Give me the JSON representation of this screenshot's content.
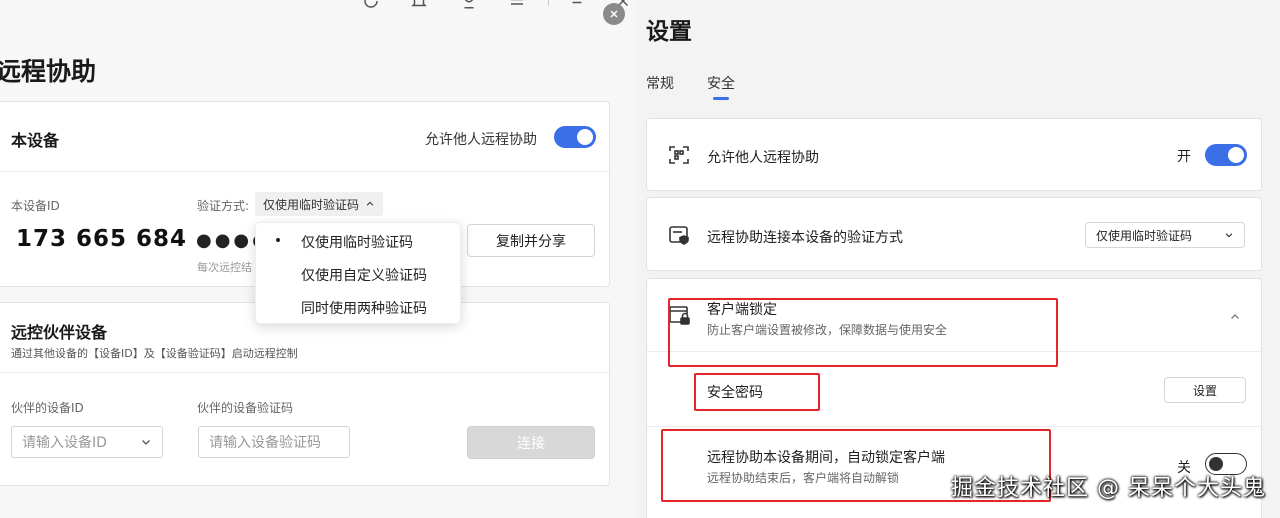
{
  "left": {
    "title": "远程协助",
    "device_card": {
      "title": "本设备",
      "allow_label": "允许他人远程协助",
      "allow_enabled": true,
      "id_label": "本设备ID",
      "device_id": "173 665 684",
      "verify_label": "验证方式:",
      "verify_value": "仅使用临时验证码",
      "password_masked": "●●●●",
      "password_hint": "每次远控结",
      "copy_button": "复制并分享",
      "verify_options": [
        "仅使用临时验证码",
        "仅使用自定义验证码",
        "同时使用两种验证码"
      ],
      "selected_option": 0
    },
    "partner_card": {
      "title": "远控伙伴设备",
      "subtitle": "通过其他设备的【设备ID】及【设备验证码】启动远程控制",
      "partner_id_label": "伙伴的设备ID",
      "partner_id_placeholder": "请输入设备ID",
      "partner_code_label": "伙伴的设备验证码",
      "partner_code_placeholder": "请输入设备验证码",
      "connect_button": "连接"
    }
  },
  "right": {
    "title": "设置",
    "tabs": [
      {
        "label": "常规",
        "active": false
      },
      {
        "label": "安全",
        "active": true
      }
    ],
    "allow_row": {
      "label": "允许他人远程协助",
      "state_label": "开",
      "enabled": true
    },
    "verify_row": {
      "label": "远程协助连接本设备的验证方式",
      "select_value": "仅使用临时验证码"
    },
    "lock_section": {
      "title": "客户端锁定",
      "subtitle": "防止客户端设置被修改，保障数据与使用安全",
      "password_label": "安全密码",
      "password_button": "设置",
      "auto_lock_label": "远程协助本设备期间，自动锁定客户端",
      "auto_lock_sub": "远程协助结束后，客户端将自动解锁",
      "auto_lock_state_label": "关",
      "auto_lock_enabled": false
    }
  },
  "watermark": "掘金技术社区 @ 呆呆个大头鬼",
  "colors": {
    "accent": "#3b6fe8",
    "highlight": "#e5252a"
  }
}
